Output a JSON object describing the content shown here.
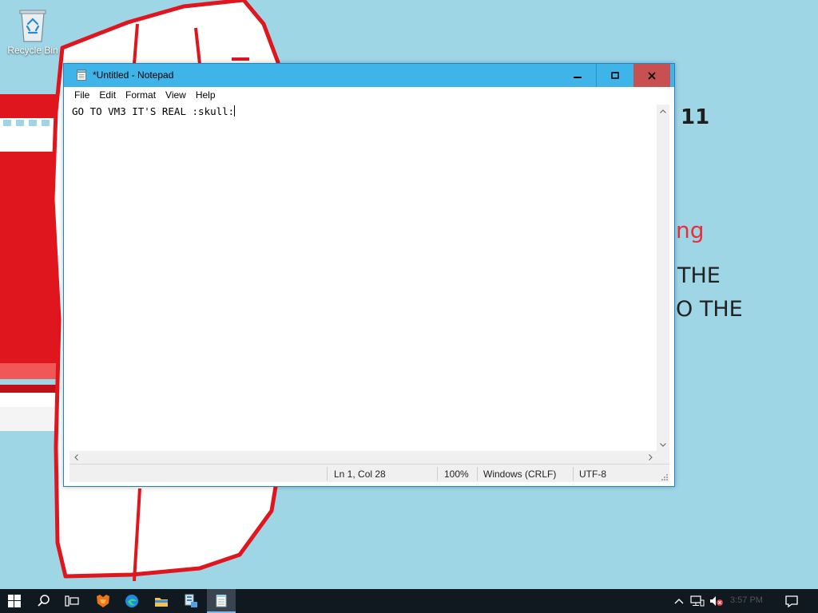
{
  "desktop": {
    "recycle_bin_label": "Recycle Bin",
    "wallpaper_text": {
      "line1": "11",
      "line2": "ng",
      "line3": "THE",
      "line4": "O THE"
    }
  },
  "notepad": {
    "title": "*Untitled - Notepad",
    "menu": [
      "File",
      "Edit",
      "Format",
      "View",
      "Help"
    ],
    "content": "GO TO VM3 IT'S REAL :skull:",
    "status": {
      "position": "Ln 1, Col 28",
      "zoom": "100%",
      "line_ending": "Windows (CRLF)",
      "encoding": "UTF-8"
    },
    "controls": {
      "minimize": "minimize-icon",
      "maximize": "maximize-icon",
      "close": "close-icon"
    }
  },
  "taskbar": {
    "icons": [
      "windows-start-icon",
      "search-icon",
      "task-view-icon",
      "firefox-icon",
      "edge-icon",
      "file-explorer-icon",
      "server-manager-icon",
      "notepad-icon"
    ],
    "clock": "3:57 PM"
  },
  "colors": {
    "desktop": "#9fd6e6",
    "titlebar": "#3fb4e8",
    "close": "#c75050",
    "drawing_red": "#e0161e",
    "taskbar": "#101820"
  }
}
